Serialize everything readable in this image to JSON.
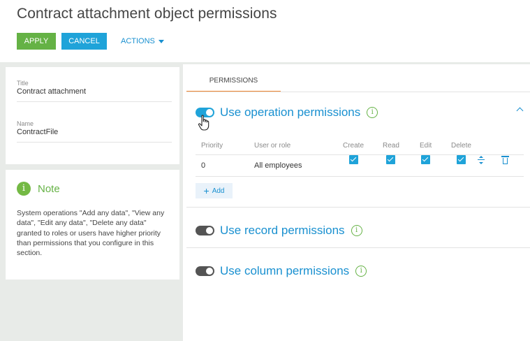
{
  "page": {
    "title": "Contract attachment object permissions"
  },
  "toolbar": {
    "apply_label": "APPLY",
    "cancel_label": "CANCEL",
    "actions_label": "ACTIONS"
  },
  "info_card": {
    "title_label": "Title",
    "title_value": "Contract attachment",
    "name_label": "Name",
    "name_value": "ContractFile"
  },
  "note": {
    "icon": "i",
    "title": "Note",
    "text": "System operations \"Add any data\", \"View any data\", \"Edit any data\", \"Delete any data\" granted to roles or users have higher priority than permissions that you configure in this section."
  },
  "tabs": [
    {
      "label": "PERMISSIONS",
      "active": true
    }
  ],
  "sections": {
    "operation": {
      "label": "Use operation permissions",
      "enabled": true,
      "expanded": true
    },
    "record": {
      "label": "Use record permissions",
      "enabled": false
    },
    "column": {
      "label": "Use column permissions",
      "enabled": false
    }
  },
  "grid": {
    "columns": [
      "Priority",
      "User or role",
      "Create",
      "Read",
      "Edit",
      "Delete"
    ],
    "rows": [
      {
        "priority": "0",
        "user_or_role": "All employees",
        "create": true,
        "read": true,
        "edit": true,
        "delete": true
      }
    ]
  },
  "add_button": {
    "label": "Add"
  },
  "colors": {
    "accent_blue": "#1fa3d9",
    "link_blue": "#1990d0",
    "green": "#65b245",
    "orange_tab": "#f08732"
  },
  "icons": {
    "info": "i"
  }
}
